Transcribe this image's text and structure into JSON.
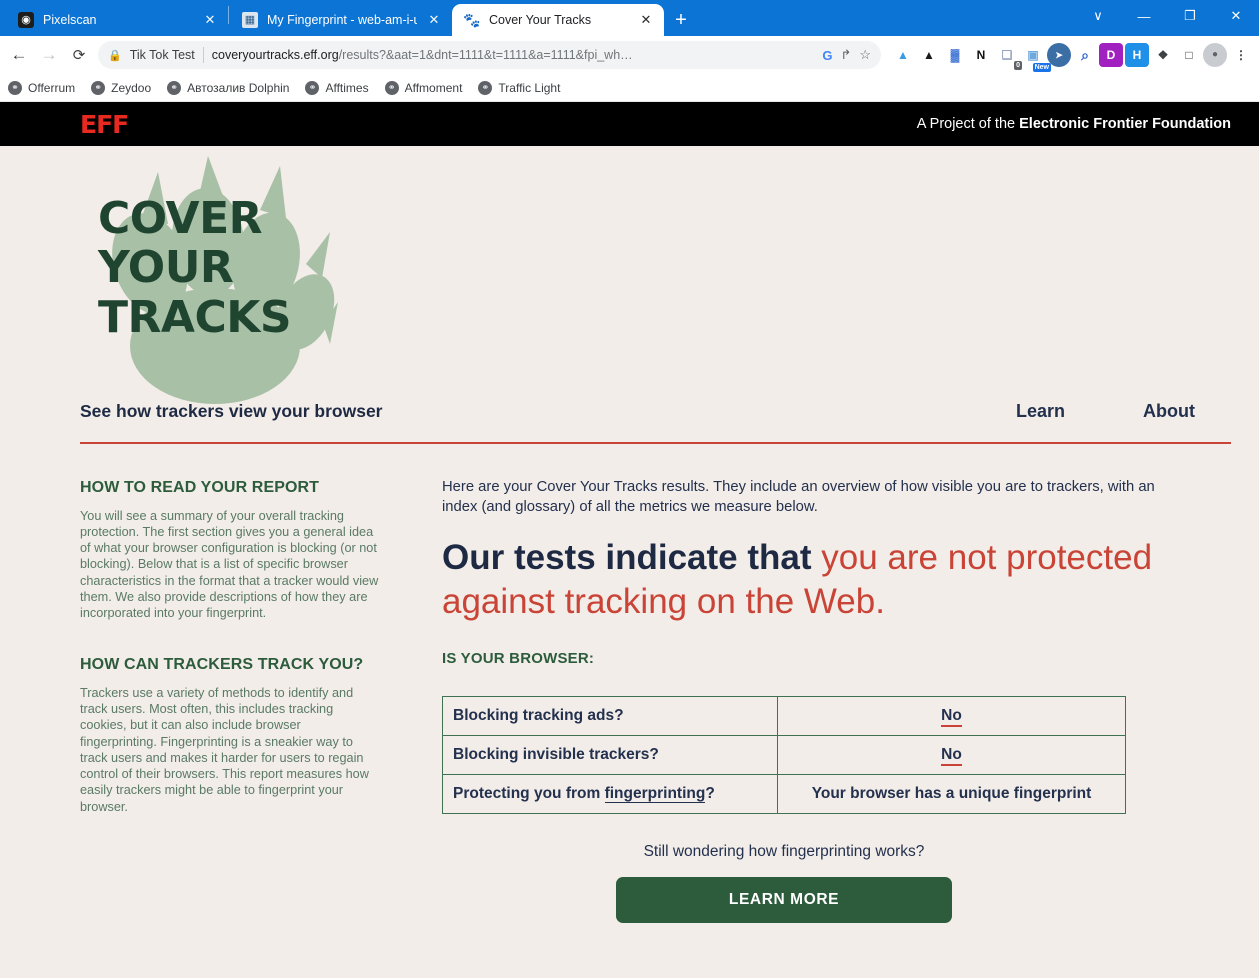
{
  "browser": {
    "tabs": [
      {
        "title": "Pixelscan",
        "favicon": "pixelscan-icon",
        "active": false
      },
      {
        "title": "My Fingerprint - web-am-i-uniq",
        "favicon": "fingerprint-icon",
        "active": false
      },
      {
        "title": "Cover Your Tracks",
        "favicon": "paw-icon",
        "active": true
      }
    ],
    "new_tab_label": "+",
    "close_label": "✕",
    "window_controls": [
      {
        "name": "tab-search",
        "glyph": "∨"
      },
      {
        "name": "minimize",
        "glyph": "—"
      },
      {
        "name": "maximize",
        "glyph": "❐"
      },
      {
        "name": "close",
        "glyph": "✕"
      }
    ],
    "nav": {
      "back": "←",
      "forward": "→",
      "reload": "⟳"
    },
    "omnibox": {
      "lock_icon": "🔒",
      "profile_chip": "Tik Tok Test",
      "url_host": "coveryourtracks.eff.org",
      "url_rest": "/results?&aat=1&dnt=1111&t=1111&a=1111&fpi_wh…",
      "actions": [
        {
          "name": "google-icon",
          "glyph": "G",
          "color": "#4285f4"
        },
        {
          "name": "share-icon",
          "glyph": "↱",
          "color": "#5f6368"
        },
        {
          "name": "bookmark-star-icon",
          "glyph": "☆",
          "color": "#5f6368"
        }
      ]
    },
    "extensions": [
      {
        "name": "ext-adguard-icon",
        "glyph": "▲",
        "bg": "#ffffff",
        "fg": "#3b9ae1"
      },
      {
        "name": "ext-adblock-icon",
        "glyph": "▲",
        "bg": "#ffffff",
        "fg": "#1a1a1a"
      },
      {
        "name": "ext-bot-icon",
        "glyph": "▓",
        "bg": "#ffffff",
        "fg": "#2b64d0"
      },
      {
        "name": "ext-notion-icon",
        "glyph": "N",
        "bg": "#ffffff",
        "fg": "#111111"
      },
      {
        "name": "ext-cookie-icon",
        "glyph": "❑",
        "bg": "#ffffff",
        "fg": "#95a5c0",
        "badge": "0"
      },
      {
        "name": "ext-screenshot-icon",
        "glyph": "▣",
        "bg": "#ffffff",
        "fg": "#6fa8dc",
        "newbadge": "New"
      },
      {
        "name": "ext-cursor-icon",
        "glyph": "➤",
        "bg": "#3b6ea5",
        "fg": "#ffffff",
        "round": true
      },
      {
        "name": "ext-search-icon",
        "glyph": "⌕",
        "bg": "#ffffff",
        "fg": "#2b64d0"
      },
      {
        "name": "ext-dashlane-icon",
        "glyph": "D",
        "bg": "#a020c0",
        "fg": "#ffffff"
      },
      {
        "name": "ext-hola-icon",
        "glyph": "H",
        "bg": "#1e90e8",
        "fg": "#ffffff"
      },
      {
        "name": "ext-puzzle-icon",
        "glyph": "❖",
        "bg": "#ffffff",
        "fg": "#3c4043"
      },
      {
        "name": "ext-sidepanel-icon",
        "glyph": "□",
        "bg": "#ffffff",
        "fg": "#3c4043"
      },
      {
        "name": "ext-profile-icon",
        "glyph": "●",
        "bg": "#c8ccd0",
        "fg": "#5f6368",
        "round": true
      },
      {
        "name": "ext-menu-icon",
        "glyph": "⋮",
        "bg": "#ffffff",
        "fg": "#3c4043"
      }
    ],
    "bookmarks": [
      {
        "label": "Offerrum",
        "icon": "globe-icon"
      },
      {
        "label": "Zeydoo",
        "icon": "globe-icon"
      },
      {
        "label": "Автозалив Dolphin",
        "icon": "globe-icon"
      },
      {
        "label": "Afftimes",
        "icon": "globe-icon"
      },
      {
        "label": "Affmoment",
        "icon": "globe-icon"
      },
      {
        "label": "Traffic Light",
        "icon": "globe-icon"
      }
    ]
  },
  "eff_bar": {
    "logo": "EFF",
    "tagline_prefix": "A Project of the ",
    "tagline_strong": "Electronic Frontier Foundation"
  },
  "site": {
    "logo_line1": "COVER",
    "logo_line2": "YOUR",
    "logo_line3": "TRACKS",
    "tagline": "See how trackers view your browser",
    "nav": [
      {
        "label": "Learn"
      },
      {
        "label": "About"
      }
    ]
  },
  "sidebar": {
    "sections": [
      {
        "heading": "HOW TO READ YOUR REPORT",
        "body": "You will see a summary of your overall tracking protection. The first section gives you a general idea of what your browser configuration is blocking (or not blocking). Below that is a list of specific browser characteristics in the format that a tracker would view them. We also provide descriptions of how they are incorporated into your fingerprint."
      },
      {
        "heading": "HOW CAN TRACKERS TRACK YOU?",
        "body": "Trackers use a variety of methods to identify and track users. Most often, this includes tracking cookies, but it can also include browser fingerprinting. Fingerprinting is a sneakier way to track users and makes it harder for users to regain control of their browsers. This report measures how easily trackers might be able to fingerprint your browser."
      }
    ]
  },
  "main": {
    "intro": "Here are your Cover Your Tracks results. They include an overview of how visible you are to trackers, with an index (and glossary) of all the metrics we measure below.",
    "headline_dark": "Our tests indicate that",
    "headline_red": "you are not protected against tracking on the Web.",
    "subhead": "IS YOUR BROWSER:",
    "table": {
      "rows": [
        {
          "question": "Blocking tracking ads?",
          "answer": "No",
          "answer_style": "underline-red"
        },
        {
          "question": "Blocking invisible trackers?",
          "answer": "No",
          "answer_style": "underline-red"
        },
        {
          "question_prefix": "Protecting you from ",
          "question_link": "fingerprinting",
          "question_suffix": "?",
          "answer": "Your browser has a unique fingerprint",
          "answer_style": "plain"
        }
      ]
    },
    "still_wondering": "Still wondering how fingerprinting works?",
    "learn_more_button": "LEARN MORE"
  },
  "colors": {
    "page_bg": "#f2ede8",
    "brand_green": "#2d5c3d",
    "accent_red": "#c94436",
    "eff_red": "#e8291f",
    "navy": "#1e2a44",
    "chrome_blue": "#0b74d4"
  }
}
